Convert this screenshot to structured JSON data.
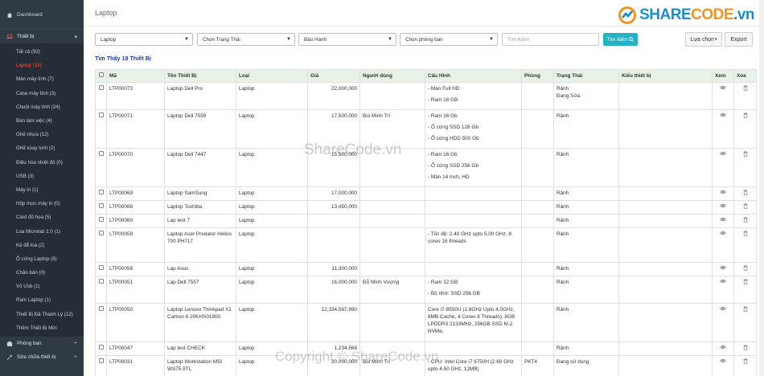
{
  "sidebar": {
    "dashboard": "Dashboard",
    "category": "Thiết bị",
    "items": [
      {
        "label": "Tất cả (93)",
        "active": false
      },
      {
        "label": "Laptop (19)",
        "active": true
      },
      {
        "label": "Màn máy tính (7)",
        "active": false
      },
      {
        "label": "Case máy tính (3)",
        "active": false
      },
      {
        "label": "Chuột máy tính (24)",
        "active": false
      },
      {
        "label": "Bàn làm việc (4)",
        "active": false
      },
      {
        "label": "Ghế nhựa (12)",
        "active": false
      },
      {
        "label": "Ghế xoay lưới (2)",
        "active": false
      },
      {
        "label": "Điều hòa nhiệt độ (0)",
        "active": false
      },
      {
        "label": "USB (3)",
        "active": false
      },
      {
        "label": "Máy in (1)",
        "active": false
      },
      {
        "label": "Hộp mực máy in (0)",
        "active": false
      },
      {
        "label": "Card đồ họa (5)",
        "active": false
      },
      {
        "label": "Loa Microlab 2.0 (1)",
        "active": false
      },
      {
        "label": "Kệ để loa (2)",
        "active": false
      },
      {
        "label": "Ổ cứng Laptop (8)",
        "active": false
      },
      {
        "label": "Chân bàn (0)",
        "active": false
      },
      {
        "label": "Vỏ Usb (1)",
        "active": false
      },
      {
        "label": "Ram Laptop (1)",
        "active": false
      },
      {
        "label": "Thiết Bị Đã Thanh Lý (12)",
        "active": false
      },
      {
        "label": "Thêm Thiết Bị Mới",
        "active": false
      }
    ],
    "footer": [
      {
        "label": "Phòng ban"
      },
      {
        "label": "Sửa chữa thiết bị"
      }
    ]
  },
  "header": {
    "title": "Laptop",
    "logo_part1": "SHARE",
    "logo_part2": "CODE",
    "logo_part3": ".vn"
  },
  "filters": {
    "type_value": "Laptop",
    "status_value": "Chọn Trạng Thái",
    "warranty_value": "Bảo Hành",
    "room_value": "Chọn phòng ban",
    "search_placeholder": "Tìm Kiếm",
    "search_button": "Tìm kiếm",
    "choose_button": "Lựa chọn",
    "export_button": "Export"
  },
  "result_text": "Tìm Thấy 19 Thiết Bị",
  "table": {
    "headers": [
      "Mã",
      "Tên Thiết Bị",
      "Loại",
      "Giá",
      "Người dùng",
      "Cấu Hình",
      "Phòng",
      "Trạng Thái",
      "Kiểu thiết bị",
      "Xem",
      "Xóa"
    ],
    "rows": [
      {
        "code": "LTP00073",
        "name": "Laptop Dell Pro",
        "type": "Laptop",
        "price": "22,000,000",
        "user": "",
        "config": [
          "- Màn Full HD",
          "- Ram 16 GB"
        ],
        "room": "",
        "status": [
          "Rảnh",
          "Đang Sửa"
        ],
        "kind": ""
      },
      {
        "code": "LTP00071",
        "name": "Laptop Dell 7559",
        "type": "Laptop",
        "price": "17,500,000",
        "user": "Bùi Minh Trí",
        "config": [
          "- Ram 16 Gb",
          "- Ổ cứng SSD 128 Gb",
          "- Ổ cứng HDD 500 Gb"
        ],
        "room": "",
        "status": [
          "Rảnh"
        ],
        "kind": ""
      },
      {
        "code": "LTP00070",
        "name": "Laptop Dell 7447",
        "type": "Laptop",
        "price": "15,500,000",
        "user": "",
        "config": [
          "- Ram 16 Gb",
          "- Ổ cứng SSD 256 Gb",
          "- Màn 14 inch, HD"
        ],
        "room": "",
        "status": [
          "Rảnh"
        ],
        "kind": ""
      },
      {
        "code": "LTP00069",
        "name": "Laptop SamSung",
        "type": "Laptop",
        "price": "17,000,000",
        "user": "",
        "config": [],
        "room": "",
        "status": [
          "Rảnh"
        ],
        "kind": ""
      },
      {
        "code": "LTP00068",
        "name": "Laptop Toshiba",
        "type": "Laptop",
        "price": "13,450,000",
        "user": "",
        "config": [],
        "room": "",
        "status": [
          "Rảnh"
        ],
        "kind": ""
      },
      {
        "code": "LTP00060",
        "name": "Lap test 7",
        "type": "Laptop",
        "price": "",
        "user": "",
        "config": [],
        "room": "",
        "status": [
          "Rảnh"
        ],
        "kind": ""
      },
      {
        "code": "LTP00059",
        "name": "Laptop Acer Predator Helios 700 PH717",
        "type": "Laptop",
        "price": "",
        "user": "",
        "config": [
          "- Tốc độ: 2.40 GHz upto 5.00 GHz, 8 cores 16 threads"
        ],
        "room": "",
        "status": [
          "Rảnh"
        ],
        "kind": ""
      },
      {
        "code": "LTP00058",
        "name": "Lap Asus",
        "type": "Laptop",
        "price": "11,300,000",
        "user": "",
        "config": [],
        "room": "",
        "status": [
          "Rảnh"
        ],
        "kind": ""
      },
      {
        "code": "LTP00051",
        "name": "Lap Dell 7557",
        "type": "Laptop",
        "price": "16,000,000",
        "user": "Đỗ Minh Vượng",
        "config": [
          "- Ram 32 GB",
          "- Bộ nhớ: SSD 256 GB"
        ],
        "room": "",
        "status": [
          "Rảnh"
        ],
        "kind": ""
      },
      {
        "code": "LTP00050",
        "name": "Laptop Lenovo Thinkpad X1 Carbon 6 20KHS01900",
        "type": "Laptop",
        "price": "12,334,567,890",
        "user": "",
        "config": [
          "Core i7-8550U (1.8GHz Upto 4.0GHz, 8MB Cache, 4 Cores 8 Threads), 8GB LPDDR3 2133MHz, 256GB SSD M.2 NVMe,"
        ],
        "room": "",
        "status": [
          "Rảnh"
        ],
        "kind": ""
      },
      {
        "code": "LTP00047",
        "name": "Lap test CHECK",
        "type": "Laptop",
        "price": "1,234,568",
        "user": "",
        "config": [],
        "room": "",
        "status": [
          "Rảnh"
        ],
        "kind": ""
      },
      {
        "code": "LTP00031",
        "name": "Laptop Workstation MSI WS75 9TL",
        "type": "Laptop",
        "price": "20,000,000",
        "user": "Bùi Minh Trí",
        "config": [
          "- CPU: Intel Core i7 9750H (2.60 GHz upto 4.50 GHz, 12MB)",
          "- RAM: DDR IV 16GB*2 (2666MHz)"
        ],
        "room": "PKT4",
        "status": [
          "Đang sử dụng"
        ],
        "kind": ""
      }
    ]
  },
  "watermarks": {
    "center": "ShareCode.vn",
    "bottom": "Copyright © ShareCode.vn"
  }
}
